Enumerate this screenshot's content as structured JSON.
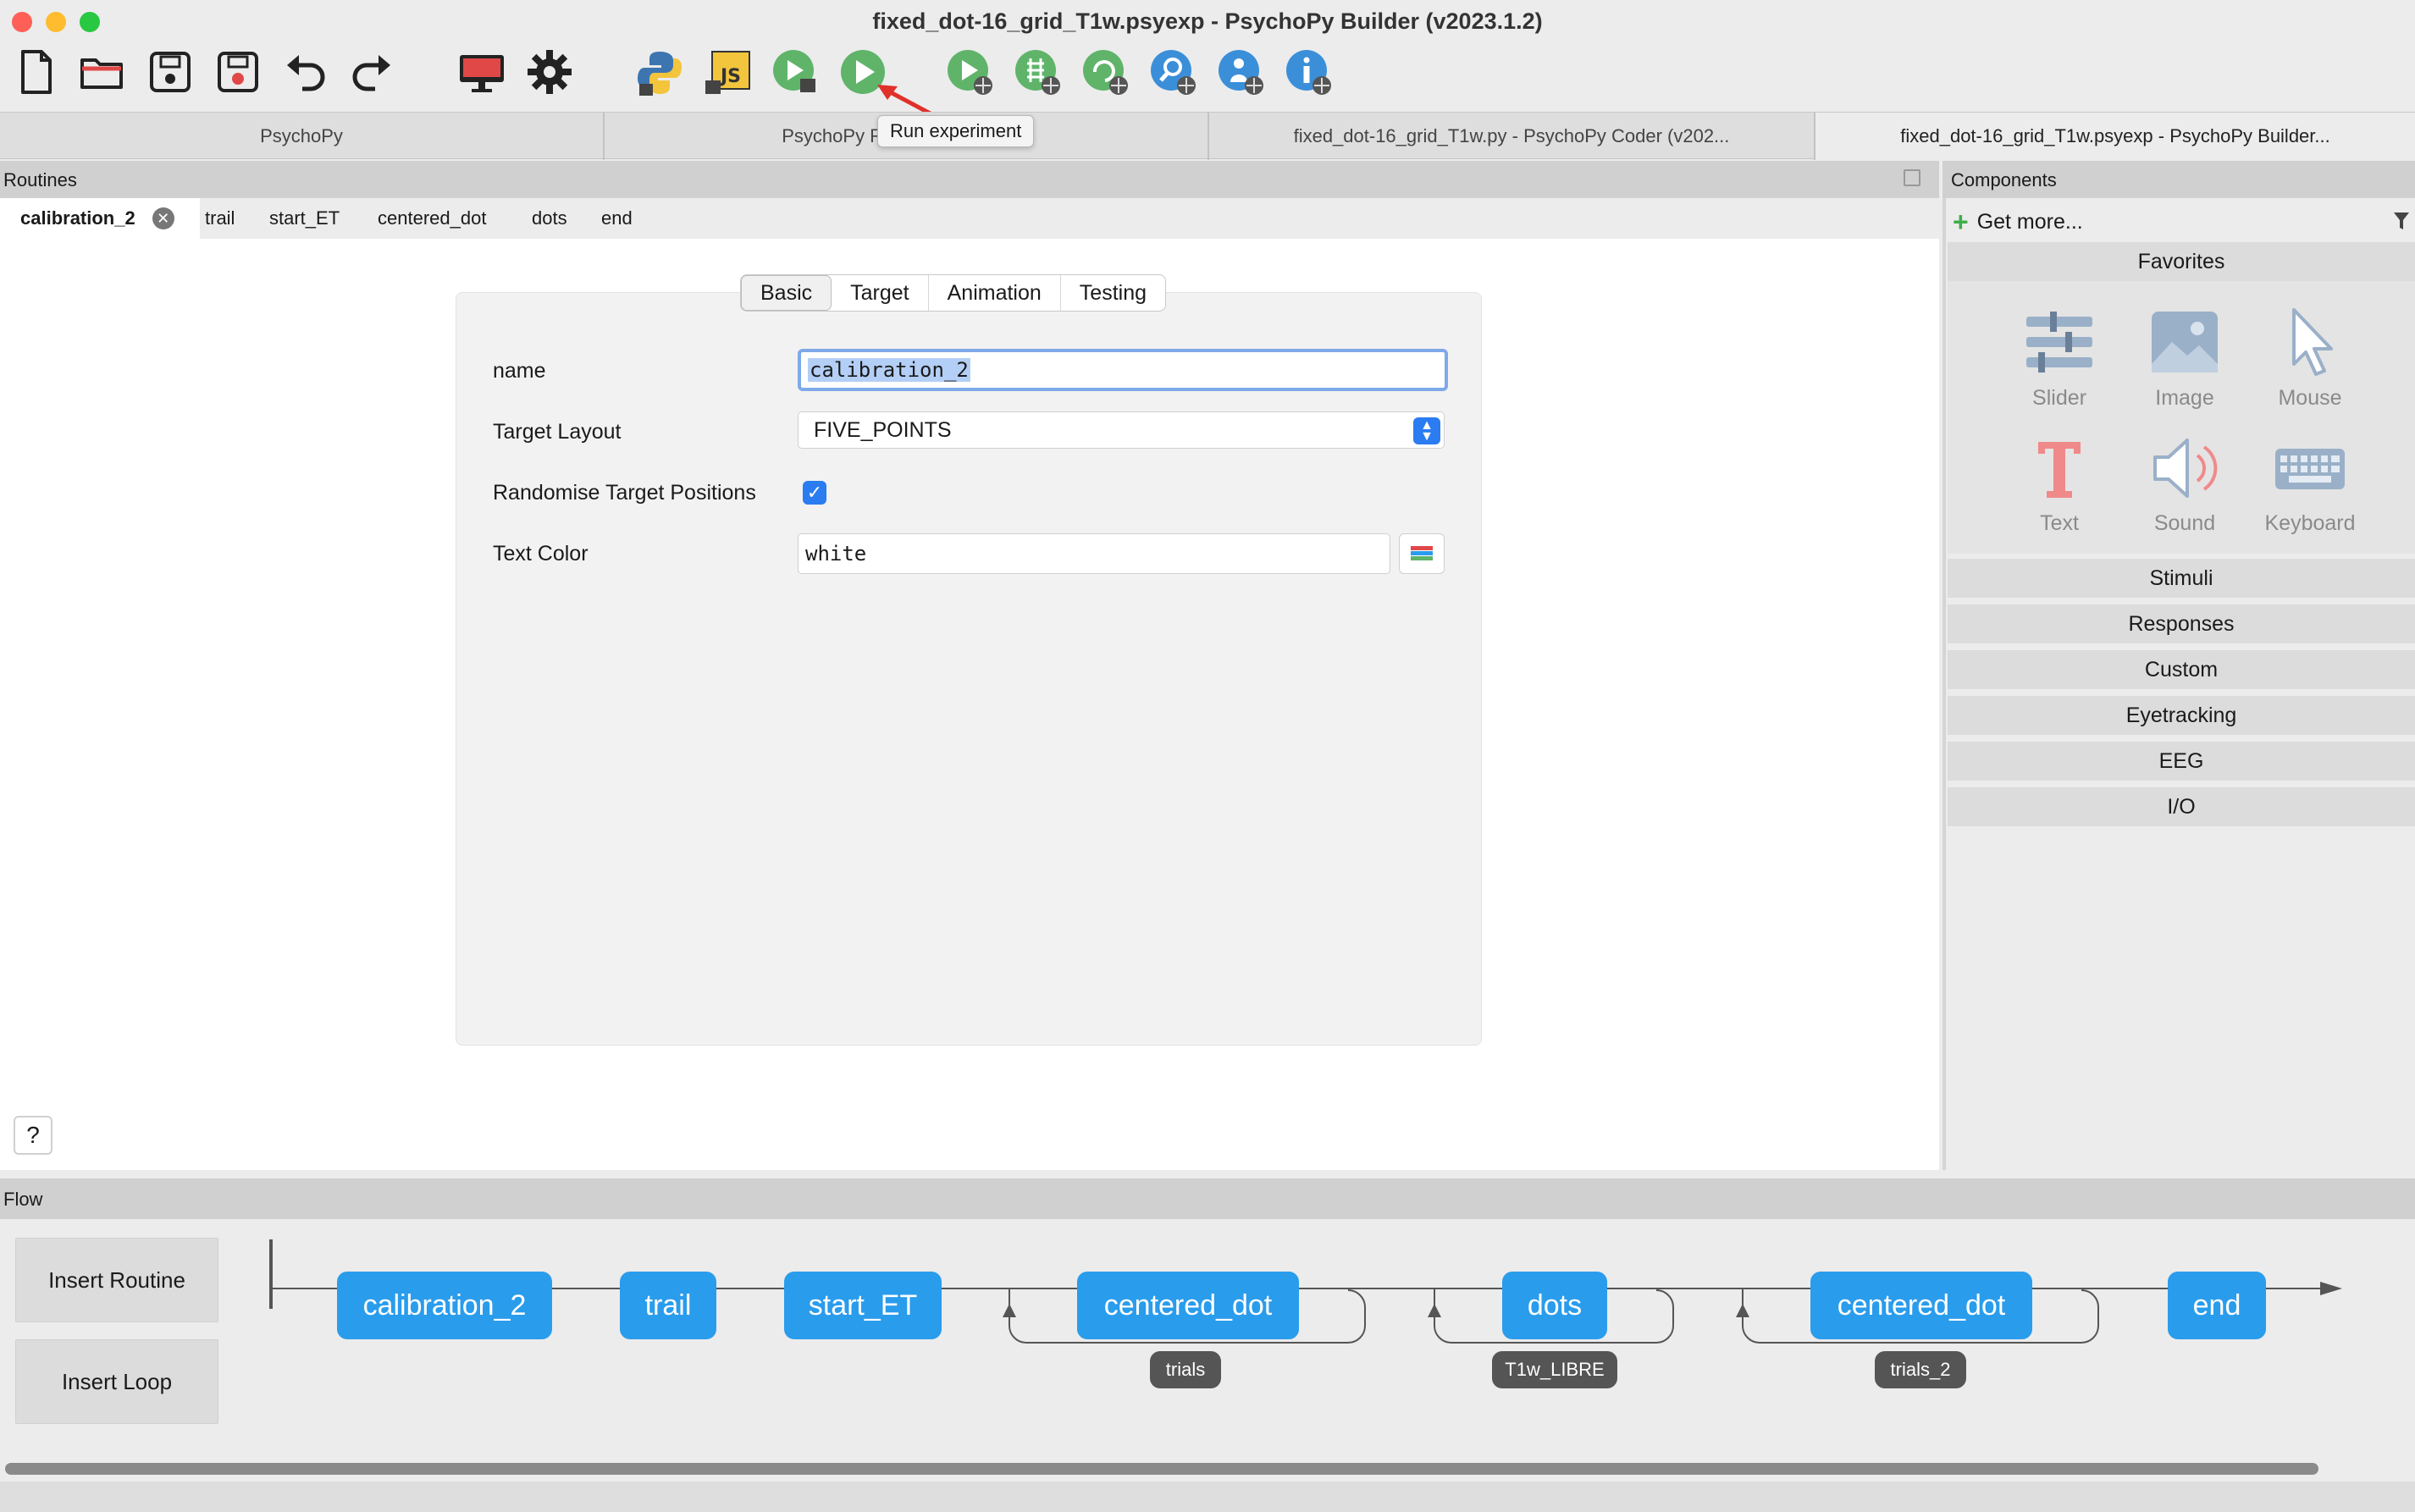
{
  "window": {
    "title": "fixed_dot-16_grid_T1w.psyexp - PsychoPy Builder (v2023.1.2)"
  },
  "toolbar": {
    "tooltip": "Run experiment",
    "buttons": [
      "new-file",
      "open-folder",
      "save",
      "save-as",
      "undo",
      "redo",
      "monitor",
      "preferences",
      "compile-python",
      "compile-js",
      "run-pilot",
      "run-experiment",
      "pilot-online",
      "sync-project",
      "run-online",
      "search-project",
      "user-info",
      "project-info"
    ]
  },
  "window_tabs": [
    {
      "label": "PsychoPy"
    },
    {
      "label": "PsychoPy Runner (v2023.1.2)"
    },
    {
      "label": "fixed_dot-16_grid_T1w.py - PsychoPy Coder (v202..."
    },
    {
      "label": "fixed_dot-16_grid_T1w.psyexp - PsychoPy Builder..."
    }
  ],
  "routines": {
    "header": "Routines",
    "tabs": [
      "calibration_2",
      "trail",
      "start_ET",
      "centered_dot",
      "dots",
      "end"
    ],
    "active_tab": "calibration_2"
  },
  "properties": {
    "tabs": [
      "Basic",
      "Target",
      "Animation",
      "Testing"
    ],
    "active_tab": "Basic",
    "fields": {
      "name_label": "name",
      "name_value": "calibration_2",
      "layout_label": "Target Layout",
      "layout_value": "FIVE_POINTS",
      "randomise_label": "Randomise Target Positions",
      "randomise_checked": true,
      "color_label": "Text Color",
      "color_value": "white"
    },
    "help": "?"
  },
  "components": {
    "header": "Components",
    "get_more": "Get more...",
    "favorites_label": "Favorites",
    "favorites": [
      {
        "label": "Slider",
        "icon": "slider-icon"
      },
      {
        "label": "Image",
        "icon": "image-icon"
      },
      {
        "label": "Mouse",
        "icon": "mouse-icon"
      },
      {
        "label": "Text",
        "icon": "text-icon"
      },
      {
        "label": "Sound",
        "icon": "sound-icon"
      },
      {
        "label": "Keyboard",
        "icon": "keyboard-icon"
      }
    ],
    "categories": [
      "Stimuli",
      "Responses",
      "Custom",
      "Eyetracking",
      "EEG",
      "I/O"
    ]
  },
  "flow": {
    "header": "Flow",
    "insert_routine": "Insert Routine",
    "insert_loop": "Insert Loop",
    "routines": [
      "calibration_2",
      "trail",
      "start_ET",
      "centered_dot",
      "dots",
      "centered_dot",
      "end"
    ],
    "loops": [
      "trials",
      "T1w_LIBRE",
      "trials_2"
    ]
  },
  "colors": {
    "routine_blue": "#2a9cec",
    "loop_gray": "#555555",
    "accent": "#2a7cf0"
  }
}
